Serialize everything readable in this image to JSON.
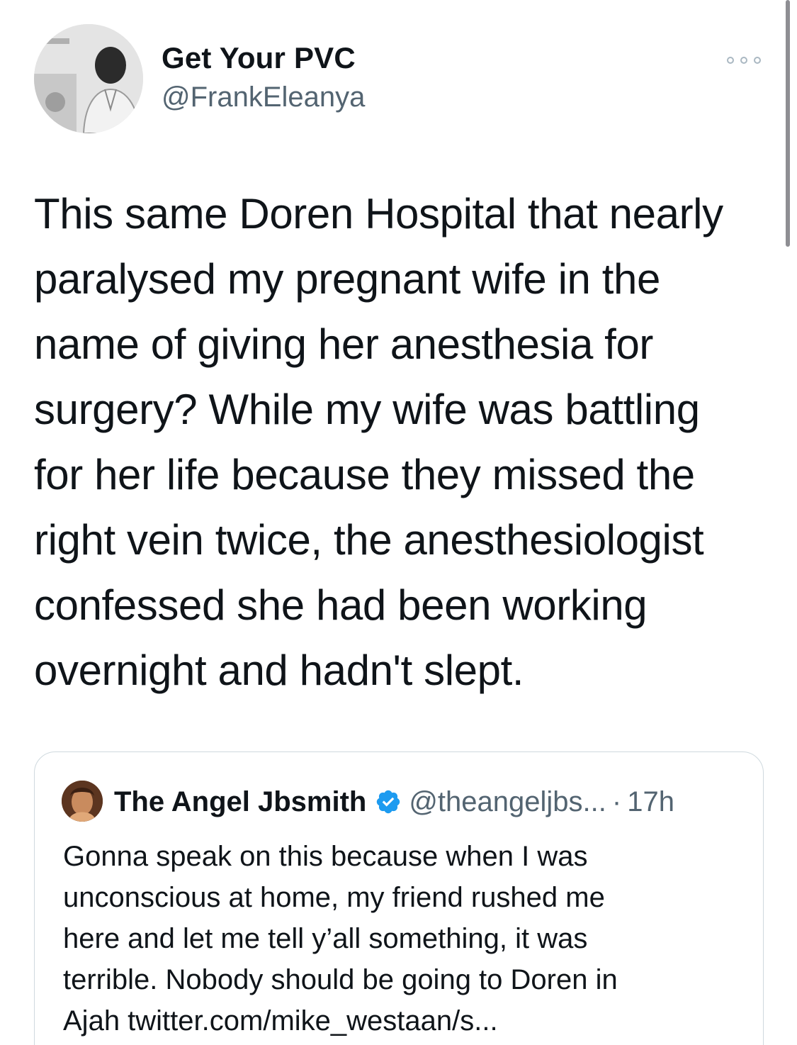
{
  "tweet": {
    "author_name": "Get Your PVC",
    "author_handle": "@FrankEleanya",
    "more_icon": "more-horizontal-icon",
    "text": "This same Doren Hospital that nearly\nparalysed my pregnant wife in the\nname of giving her anesthesia for\nsurgery? While my wife was battling\nfor her life because they missed the\nright vein twice, the anesthesiologist\nconfessed she had been working\novernight and hadn't slept."
  },
  "quoted_tweet": {
    "author_name": "The Angel Jbsmith",
    "verified_icon": "verified-badge-icon",
    "author_handle": "@theangeljbs...",
    "separator": "·",
    "time": "17h",
    "text": "Gonna speak on this because when I was\nunconscious at home, my friend rushed me\nhere and let me tell y’all something, it was\nterrible. Nobody should be going to Doren in\nAjah twitter.com/mike_westaan/s..."
  },
  "colors": {
    "text_primary": "#0f1419",
    "text_secondary": "#536471",
    "border": "#cfd9de",
    "verified_blue": "#1d9bf0"
  }
}
